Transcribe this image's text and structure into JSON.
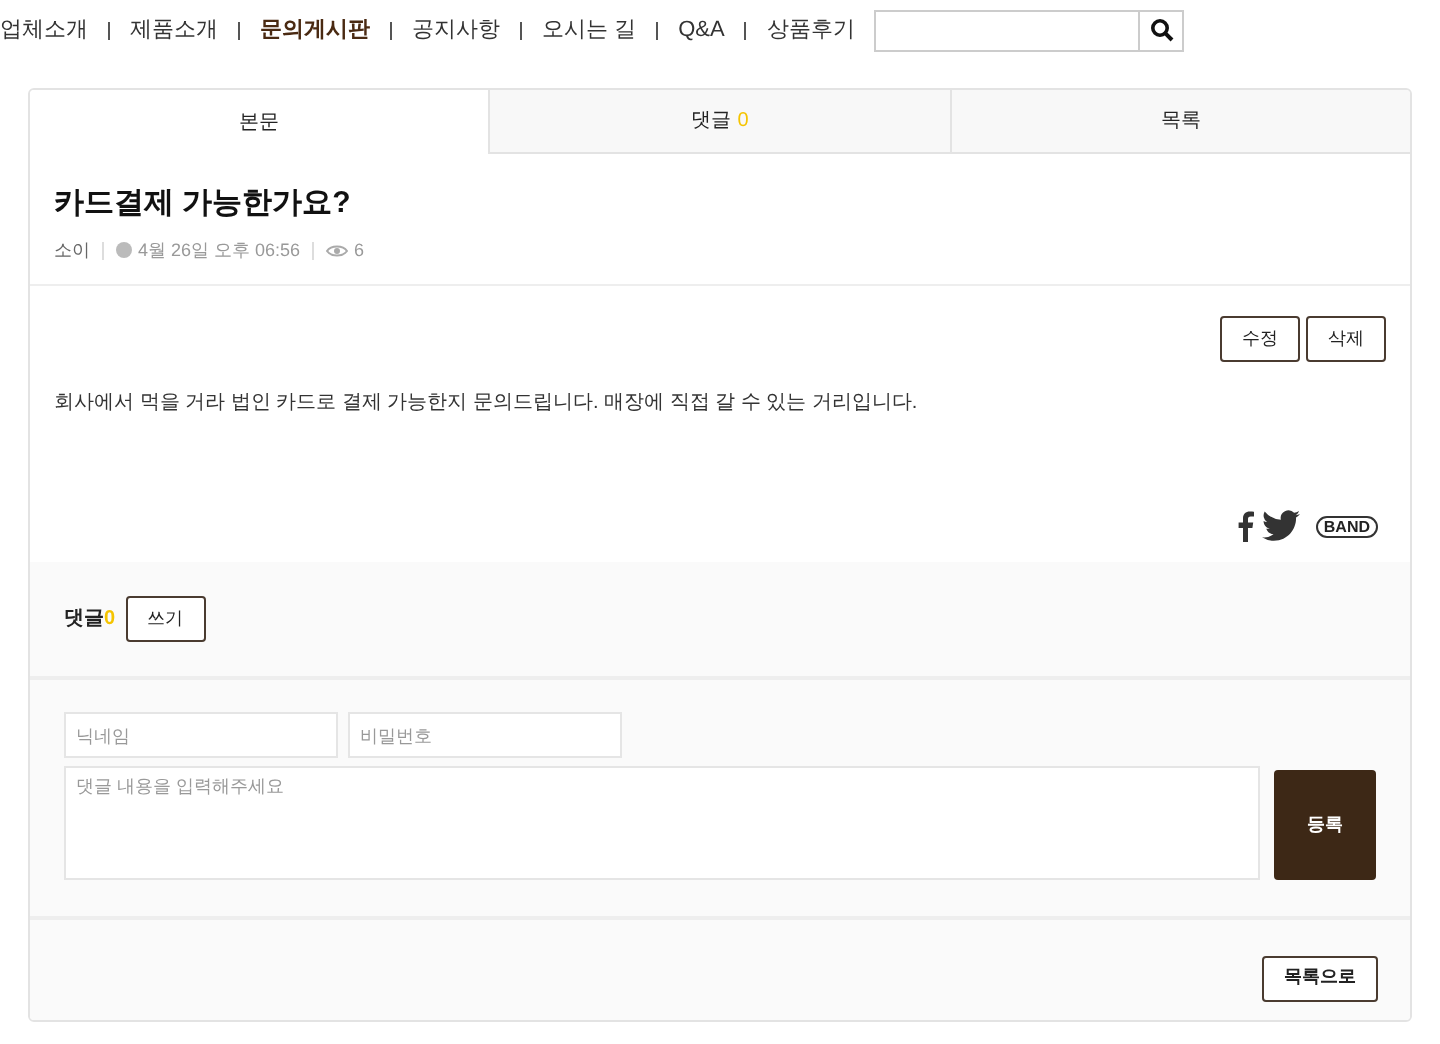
{
  "nav": [
    {
      "label": "업체소개",
      "selected": false
    },
    {
      "label": "제품소개",
      "selected": false
    },
    {
      "label": "문의게시판",
      "selected": true
    },
    {
      "label": "공지사항",
      "selected": false
    },
    {
      "label": "오시는 길",
      "selected": false
    },
    {
      "label": "Q&A",
      "selected": false
    },
    {
      "label": "상품후기",
      "selected": false
    }
  ],
  "tabs": [
    {
      "label": "본문",
      "selected": true
    },
    {
      "label": "댓글",
      "count": "0",
      "selected": false
    },
    {
      "label": "목록",
      "selected": false
    }
  ],
  "post": {
    "title": "카드결제 가능한가요?",
    "author": "소이",
    "date": "4월 26일 오후 06:56",
    "views": "6",
    "actions": [
      "수정",
      "삭제"
    ],
    "body": "회사에서 먹을 거라 법인 카드로 결제 가능한지 문의드립니다. 매장에 직접 갈 수 있는 거리입니다.",
    "share_band": "BAND"
  },
  "comments": {
    "label": "댓글",
    "count": "0",
    "write_button": "쓰기",
    "nickname_placeholder": "닉네임",
    "password_placeholder": "비밀번호",
    "content_placeholder": "댓글 내용을 입력해주세요",
    "submit": "등록"
  },
  "back_button": "목록으로"
}
